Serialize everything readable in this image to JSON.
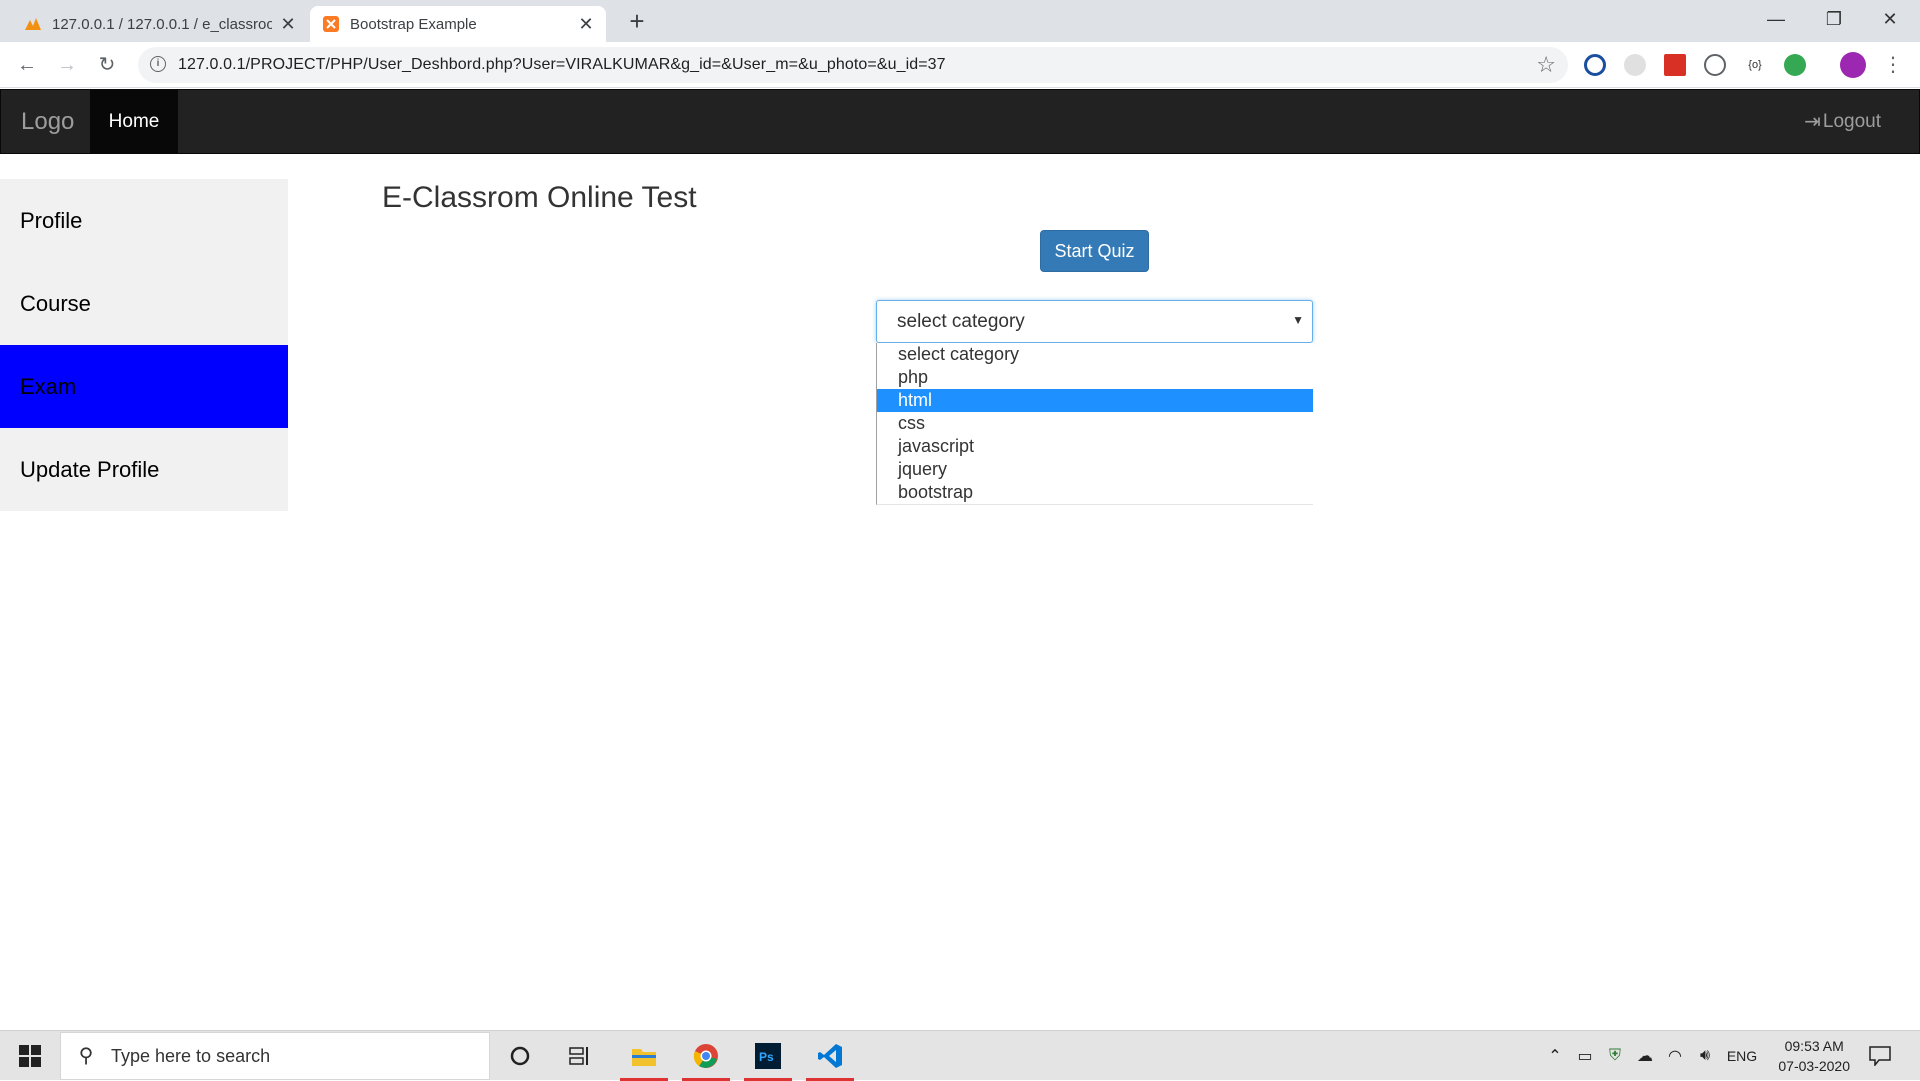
{
  "browser": {
    "tabs": [
      {
        "title": "127.0.0.1 / 127.0.0.1 / e_classroom",
        "favicon": "phpmyadmin-icon"
      },
      {
        "title": "Bootstrap Example",
        "favicon": "xampp-icon"
      }
    ],
    "new_tab": "+",
    "url": "127.0.0.1/PROJECT/PHP/User_Deshbord.php?User=VIRALKUMAR&g_id=&User_m=&u_photo=&u_id=37"
  },
  "navbar": {
    "brand": "Logo",
    "home": "Home",
    "logout": "Logout"
  },
  "sidebar": {
    "items": [
      {
        "label": "Profile",
        "active": false
      },
      {
        "label": "Course",
        "active": false
      },
      {
        "label": "Exam",
        "active": true
      },
      {
        "label": "Update Profile",
        "active": false
      }
    ]
  },
  "main": {
    "title": "E-Classrom Online Test",
    "start_button": "Start Quiz",
    "select": {
      "value": "select category",
      "options": [
        "select category",
        "php",
        "html",
        "css",
        "javascript",
        "jquery",
        "bootstrap"
      ],
      "highlighted": "html"
    }
  },
  "taskbar": {
    "search_placeholder": "Type here to search",
    "language": "ENG",
    "time": "09:53 AM",
    "date": "07-03-2020"
  },
  "colors": {
    "navbar_bg": "#222222",
    "active_sidebar": "#0000ff",
    "primary_button": "#337ab7",
    "option_highlight": "#1e90ff"
  }
}
